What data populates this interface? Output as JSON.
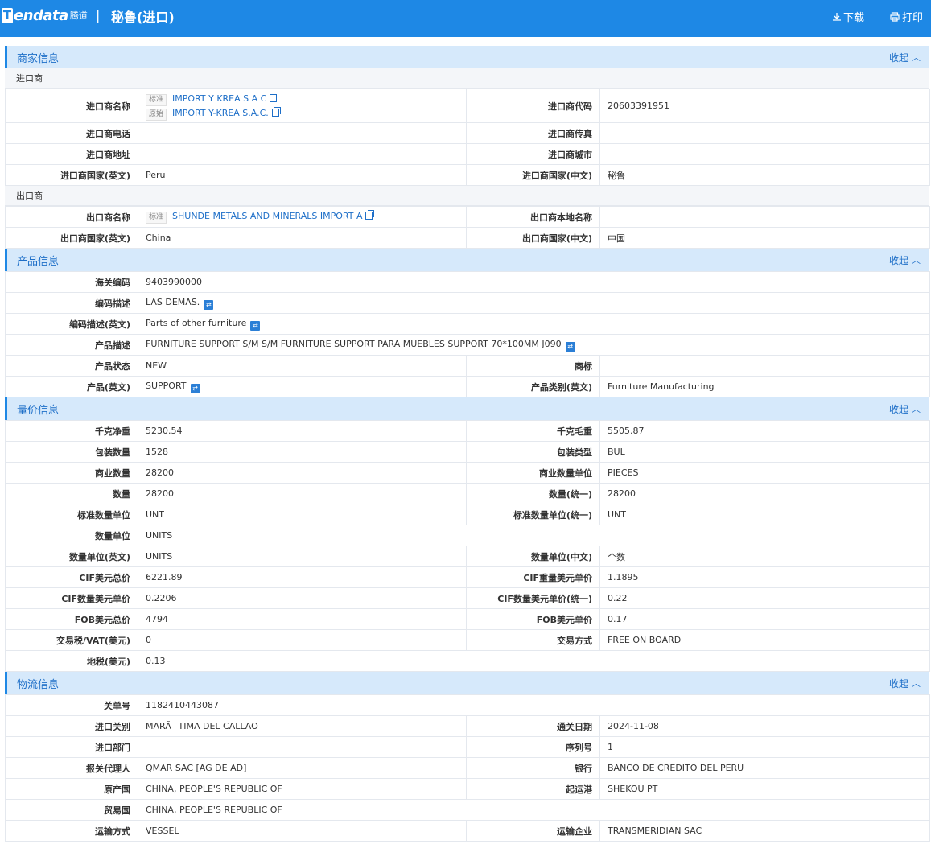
{
  "header": {
    "logo_mark": "T",
    "logo_word": "endata",
    "logo_cn": "腾道",
    "separator": "|",
    "title": "秘鲁(进口)",
    "download_label": "下载",
    "print_label": "打印"
  },
  "collapse_label": "收起",
  "merchant": {
    "title": "商家信息",
    "importer_heading": "进口商",
    "importer_name_label": "进口商名称",
    "std_tag": "标准",
    "orig_tag": "原始",
    "importer_name_std": "IMPORT Y KREA S A C",
    "importer_name_orig": "IMPORT Y-KREA S.A.C.",
    "importer_code_label": "进口商代码",
    "importer_code": "20603391951",
    "importer_phone_label": "进口商电话",
    "importer_phone": "",
    "importer_fax_label": "进口商传真",
    "importer_fax": "",
    "importer_address_label": "进口商地址",
    "importer_address": "",
    "importer_city_label": "进口商城市",
    "importer_city": "",
    "importer_country_en_label": "进口商国家(英文)",
    "importer_country_en": "Peru",
    "importer_country_cn_label": "进口商国家(中文)",
    "importer_country_cn": "秘鲁",
    "exporter_heading": "出口商",
    "exporter_name_label": "出口商名称",
    "exporter_name_std": "SHUNDE METALS AND MINERALS IMPORT A",
    "exporter_local_name_label": "出口商本地名称",
    "exporter_local_name": "",
    "exporter_country_en_label": "出口商国家(英文)",
    "exporter_country_en": "China",
    "exporter_country_cn_label": "出口商国家(中文)",
    "exporter_country_cn": "中国"
  },
  "product": {
    "title": "产品信息",
    "hs_code_label": "海关编码",
    "hs_code": "9403990000",
    "code_desc_label": "编码描述",
    "code_desc": "LAS DEMAS.",
    "code_desc_en_label": "编码描述(英文)",
    "code_desc_en": "Parts of other furniture",
    "product_desc_label": "产品描述",
    "product_desc": "FURNITURE SUPPORT S/M S/M FURNITURE SUPPORT PARA MUEBLES SUPPORT 70*100MM J090",
    "status_label": "产品状态",
    "status": "NEW",
    "brand_label": "商标",
    "brand": "",
    "product_en_label": "产品(英文)",
    "product_en": "SUPPORT",
    "category_en_label": "产品类别(英文)",
    "category_en": "Furniture Manufacturing"
  },
  "quantity": {
    "title": "量价信息",
    "rows": [
      {
        "l1": "千克净重",
        "v1": "5230.54",
        "l2": "千克毛重",
        "v2": "5505.87"
      },
      {
        "l1": "包装数量",
        "v1": "1528",
        "l2": "包装类型",
        "v2": "BUL"
      },
      {
        "l1": "商业数量",
        "v1": "28200",
        "l2": "商业数量单位",
        "v2": "PIECES"
      },
      {
        "l1": "数量",
        "v1": "28200",
        "l2": "数量(统一)",
        "v2": "28200"
      },
      {
        "l1": "标准数量单位",
        "v1": "UNT",
        "l2": "标准数量单位(统一)",
        "v2": "UNT"
      },
      {
        "l1": "数量单位",
        "v1": "UNITS"
      },
      {
        "l1": "数量单位(英文)",
        "v1": "UNITS",
        "l2": "数量单位(中文)",
        "v2": "个数"
      },
      {
        "l1": "CIF美元总价",
        "v1": "6221.89",
        "l2": "CIF重量美元单价",
        "v2": "1.1895"
      },
      {
        "l1": "CIF数量美元单价",
        "v1": "0.2206",
        "l2": "CIF数量美元单价(统一)",
        "v2": "0.22"
      },
      {
        "l1": "FOB美元总价",
        "v1": "4794",
        "l2": "FOB美元单价",
        "v2": "0.17"
      },
      {
        "l1": "交易税/VAT(美元)",
        "v1": "0",
        "l2": "交易方式",
        "v2": "FREE ON BOARD"
      },
      {
        "l1": "地税(美元)",
        "v1": "0.13"
      }
    ]
  },
  "logistics": {
    "title": "物流信息",
    "rows": [
      {
        "l1": "关单号",
        "v1": "1182410443087"
      },
      {
        "l1": "进口关别",
        "v1": "MARÃTIMA DEL CALLAO",
        "l2": "通关日期",
        "v2": "2024-11-08"
      },
      {
        "l1": "进口部门",
        "v1": "",
        "l2": "序列号",
        "v2": "1"
      },
      {
        "l1": "报关代理人",
        "v1": "QMAR SAC [AG DE AD]",
        "l2": "银行",
        "v2": "BANCO DE CREDITO DEL PERU"
      },
      {
        "l1": "原产国",
        "v1": "CHINA, PEOPLE'S REPUBLIC OF",
        "l2": "起运港",
        "v2": "SHEKOU PT"
      },
      {
        "l1": "贸易国",
        "v1": "CHINA, PEOPLE'S REPUBLIC OF"
      },
      {
        "l1": "运输方式",
        "v1": "VESSEL",
        "l2": "运输企业",
        "v2": "TRANSMERIDIAN SAC"
      }
    ]
  }
}
